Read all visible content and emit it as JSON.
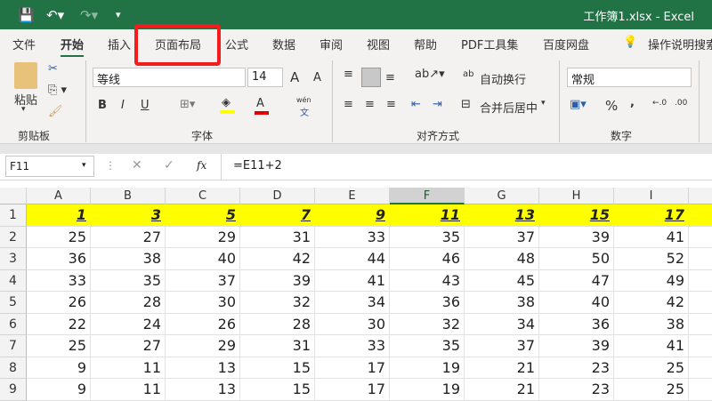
{
  "title": "工作簿1.xlsx  -  Excel",
  "quick_access": {
    "save": "save-icon",
    "undo": "undo-icon",
    "redo": "redo-icon",
    "customize": "customize-icon"
  },
  "tabs": [
    "文件",
    "开始",
    "插入",
    "页面布局",
    "公式",
    "数据",
    "审阅",
    "视图",
    "帮助",
    "PDF工具集",
    "百度网盘"
  ],
  "search_label": "操作说明搜索",
  "ribbon": {
    "clipboard": {
      "paste": "粘贴",
      "label": "剪贴板"
    },
    "font": {
      "name": "等线",
      "size": "14",
      "bold": "B",
      "italic": "I",
      "underline": "U",
      "grow": "A",
      "shrink": "A",
      "phonetic": "wén",
      "phonetic_char": "文",
      "font_color": "A",
      "label": "字体",
      "fill_color": "#ffff00",
      "text_color": "#e00000"
    },
    "alignment": {
      "wrap": "自动换行",
      "merge": "合并后居中",
      "label": "对齐方式"
    },
    "number": {
      "format": "常规",
      "percent": "%",
      "comma": ",",
      "label": "数字"
    }
  },
  "formula_bar": {
    "name_box": "F11",
    "fx": "fx",
    "formula": "=E11+2"
  },
  "columns": [
    "A",
    "B",
    "C",
    "D",
    "E",
    "F",
    "G",
    "H",
    "I"
  ],
  "selected_column": "F",
  "rows": [
    [
      "1",
      "3",
      "5",
      "7",
      "9",
      "11",
      "13",
      "15",
      "17"
    ],
    [
      "25",
      "27",
      "29",
      "31",
      "33",
      "35",
      "37",
      "39",
      "41"
    ],
    [
      "36",
      "38",
      "40",
      "42",
      "44",
      "46",
      "48",
      "50",
      "52"
    ],
    [
      "33",
      "35",
      "37",
      "39",
      "41",
      "43",
      "45",
      "47",
      "49"
    ],
    [
      "26",
      "28",
      "30",
      "32",
      "34",
      "36",
      "38",
      "40",
      "42"
    ],
    [
      "22",
      "24",
      "26",
      "28",
      "30",
      "32",
      "34",
      "36",
      "38"
    ],
    [
      "25",
      "27",
      "29",
      "31",
      "33",
      "35",
      "37",
      "39",
      "41"
    ],
    [
      "9",
      "11",
      "13",
      "15",
      "17",
      "19",
      "21",
      "23",
      "25"
    ],
    [
      "9",
      "11",
      "13",
      "15",
      "17",
      "19",
      "21",
      "23",
      "25"
    ]
  ],
  "row_numbers": [
    "1",
    "2",
    "3",
    "4",
    "5",
    "6",
    "7",
    "8",
    "9"
  ]
}
